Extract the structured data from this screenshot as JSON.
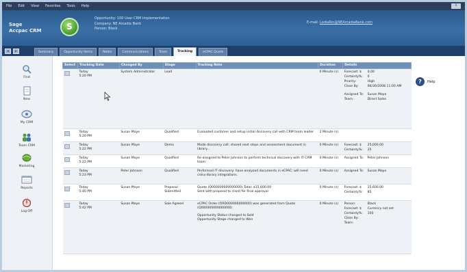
{
  "menu": [
    "File",
    "Edit",
    "View",
    "Favorites",
    "Tools",
    "Help"
  ],
  "window_close": "X",
  "brand": [
    "Sage",
    "Accpac CRM"
  ],
  "logo_letter": "S",
  "opportunity_info": [
    "Opportunity: 100 User CRM Implementation",
    "Company: NE Arcadia Bank",
    "Person: Black"
  ],
  "email": {
    "label": "E-mail:",
    "address": "LodiaRin@NEArcadiaBank.com"
  },
  "nav_buttons": [
    "◂",
    "▸"
  ],
  "tabs": [
    {
      "label": "Summary",
      "active": false
    },
    {
      "label": "Opportunity Items",
      "active": false
    },
    {
      "label": "Notes",
      "active": false
    },
    {
      "label": "Communications",
      "active": false
    },
    {
      "label": "Team",
      "active": false
    },
    {
      "label": "Tracking",
      "active": true
    },
    {
      "label": "eCPAC Quote",
      "active": false
    }
  ],
  "sidebar": [
    {
      "label": "Find",
      "icon": "magnifier-icon"
    },
    {
      "label": "New",
      "icon": "new-document-icon"
    },
    {
      "label": "My CRM",
      "icon": "my-crm-icon"
    },
    {
      "label": "Team CRM",
      "icon": "team-icon"
    },
    {
      "label": "Marketing",
      "icon": "marketing-icon"
    },
    {
      "label": "Reports",
      "icon": "reports-icon"
    },
    {
      "label": "Log Off",
      "icon": "log-off-icon"
    }
  ],
  "table": {
    "headers": [
      "Select",
      "Tracking Date",
      "Changed By",
      "Stage",
      "Tracking Note",
      "Duration",
      "Details"
    ],
    "rows": [
      {
        "date": [
          "Today",
          "5:20 PM"
        ],
        "changed_by": "System Administrator",
        "stage": "Lead",
        "note": [],
        "duration": "0 Minute (s)",
        "details": [
          [
            "Forecast: $",
            "0.00"
          ],
          [
            "Certainty%:",
            "0"
          ],
          [
            "Priority:",
            "High"
          ],
          [
            "Close By:",
            "06/30/2008 11:00 AM"
          ],
          [
            "",
            ""
          ],
          [
            "Assigned To:",
            "Susan Maye"
          ],
          [
            "Team:",
            "Direct Sales"
          ]
        ]
      },
      {
        "date": [
          "Today",
          "5:20 PM"
        ],
        "changed_by": "Susan Maye",
        "stage": "Qualified",
        "note": [
          "Evaluated customer and setup initial discovery call with CRM team leader"
        ],
        "duration": "2 Minute (s)",
        "details": []
      },
      {
        "date": [
          "Today",
          "5:22 PM"
        ],
        "changed_by": "Susan Maye",
        "stage": "Demo",
        "note": [
          "Made discovery call; shared next steps and assessment document in library..."
        ],
        "duration": "0 Minute (s)",
        "details": [
          [
            "Forecast: $",
            "25,000.00"
          ],
          [
            "Certainty%:",
            "25"
          ]
        ]
      },
      {
        "date": [
          "Today",
          "5:22 PM"
        ],
        "changed_by": "Susan Maye",
        "stage": "Qualified",
        "note": [
          "Re-assigned to Peter Johnson to perform technical discovery with IT CRM team."
        ],
        "duration": "0 Minute (s)",
        "details": [
          [
            "Assigned To:",
            "Peter Johnson"
          ]
        ]
      },
      {
        "date": [
          "Today",
          "5:23 PM"
        ],
        "changed_by": "Peter Johnson",
        "stage": "Qualified",
        "note": [
          "Performed IT discovery: have analyzed documents in eCPAC; will need cross-library integrations."
        ],
        "duration": "0 Minute (s)",
        "details": [
          [
            "Assigned To:",
            "Susan Maye"
          ]
        ]
      },
      {
        "date": [
          "Today",
          "5:40 PM"
        ],
        "changed_by": "Susan Maye",
        "stage": "Proposal Submitted",
        "note": [
          "Quote (Q000000000000000) Total: $15,600.00",
          "Sent with proposal to client for final approval"
        ],
        "duration": "0 Minute (s)",
        "details": [
          [
            "Forecast: $",
            "15,600.00"
          ],
          [
            "Certainty%:",
            "85"
          ]
        ]
      },
      {
        "date": [
          "Today",
          "5:42 PM"
        ],
        "changed_by": "Susan Maye",
        "stage": "Sale Agreed",
        "note": [
          "eCPAC Order (ORD000000000000) was generated from Quote (Q000000000000000)",
          "",
          "Opportunity Status changed to Sold",
          "Opportunity Stage changed to Won"
        ],
        "duration": "0 Minute (s)",
        "details": [
          [
            "Person:",
            "Black"
          ],
          [
            "Forecast: $",
            "Currency not set"
          ],
          [
            "Certainty%:",
            "100"
          ],
          [
            "Close By:",
            ""
          ],
          [
            "Team:",
            ""
          ]
        ]
      }
    ]
  },
  "help_label": "Help",
  "colors": {
    "header_blue": "#2b5a8d",
    "tab_bar": "#1f3f6b",
    "table_header": "#6f8fb6",
    "logo_green": "#4ea534"
  }
}
